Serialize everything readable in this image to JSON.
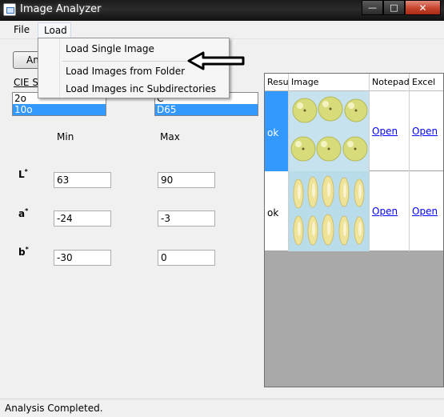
{
  "window": {
    "title": "Image Analyzer"
  },
  "menu": {
    "file": "File",
    "load": "Load"
  },
  "load_menu": {
    "items": [
      "Load Single Image",
      "Load Images from Folder",
      "Load Images inc Subdirectories"
    ]
  },
  "toolbar": {
    "analyze_label": "Ana"
  },
  "cie": {
    "label": "CIE St",
    "observer_options": [
      "2o",
      "10o"
    ],
    "observer_selected": "10o",
    "illuminant_options": [
      "C",
      "D65"
    ],
    "illuminant_selected": "D65"
  },
  "range": {
    "min_label": "Min",
    "max_label": "Max",
    "rows": [
      {
        "label": "L",
        "sup": "*",
        "min": "63",
        "max": "90"
      },
      {
        "label": "a",
        "sup": "*",
        "min": "-24",
        "max": "-3"
      },
      {
        "label": "b",
        "sup": "*",
        "min": "-30",
        "max": "0"
      }
    ]
  },
  "grid": {
    "headers": [
      "Resu",
      "Image",
      "Notepad",
      "Excel"
    ],
    "rows": [
      {
        "result": "ok",
        "image": "whole-apples",
        "notepad": "Open",
        "excel": "Open"
      },
      {
        "result": "ok",
        "image": "sliced-apples",
        "notepad": "Open",
        "excel": "Open"
      }
    ]
  },
  "status": {
    "text": "Analysis Completed."
  },
  "colors": {
    "selection": "#3399ff",
    "link": "#0000ff",
    "grid_empty": "#a9a9a9"
  }
}
